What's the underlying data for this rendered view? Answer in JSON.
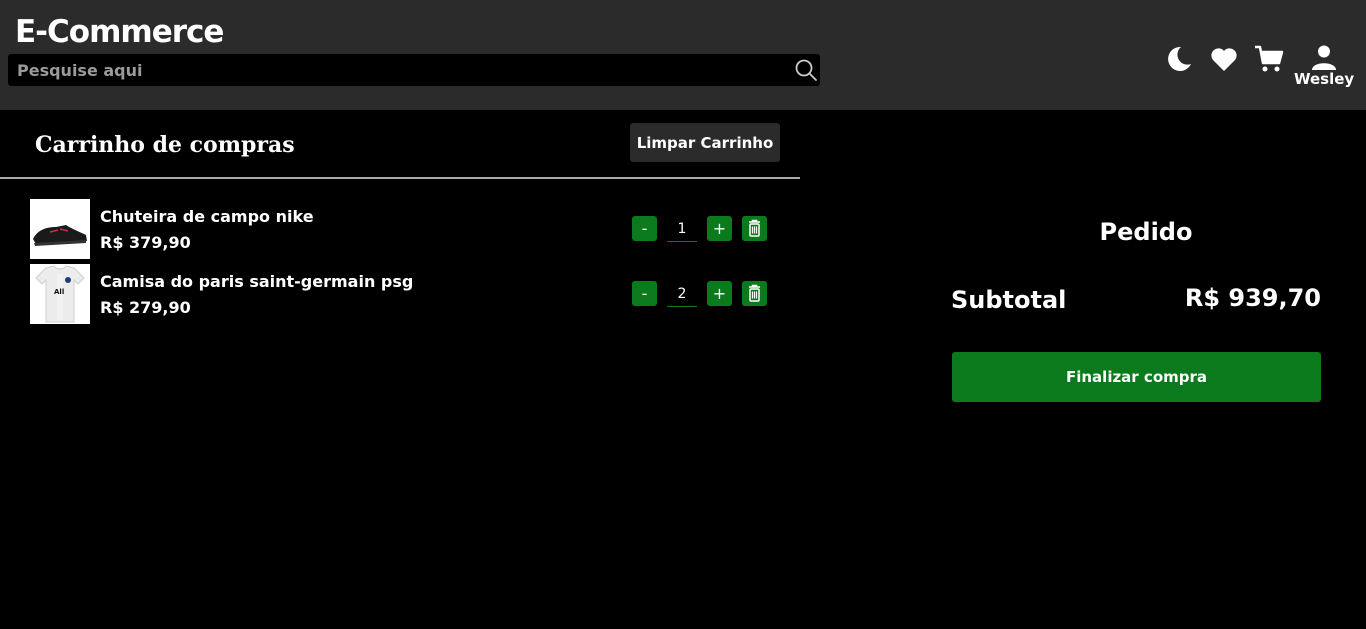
{
  "header": {
    "brand": "E-Commerce",
    "search_placeholder": "Pesquise aqui",
    "icons": [
      "moon-icon",
      "heart-icon",
      "cart-icon",
      "user-icon"
    ],
    "user_name": "Wesley"
  },
  "cart": {
    "title": "Carrinho de compras",
    "clear_label": "Limpar Carrinho",
    "items": [
      {
        "name": "Chuteira de campo nike",
        "price": "R$ 379,90",
        "quantity": "1",
        "minus": "-",
        "plus": "+"
      },
      {
        "name": "Camisa do paris saint-germain psg",
        "price": "R$ 279,90",
        "quantity": "2",
        "minus": "-",
        "plus": "+"
      }
    ]
  },
  "order": {
    "title": "Pedido",
    "subtotal_label": "Subtotal",
    "subtotal_value": "R$ 939,70",
    "checkout_label": "Finalizar compra"
  },
  "colors": {
    "header_bg": "#2b2b2b",
    "accent_green": "#0a7a1c",
    "page_bg": "#000000"
  }
}
